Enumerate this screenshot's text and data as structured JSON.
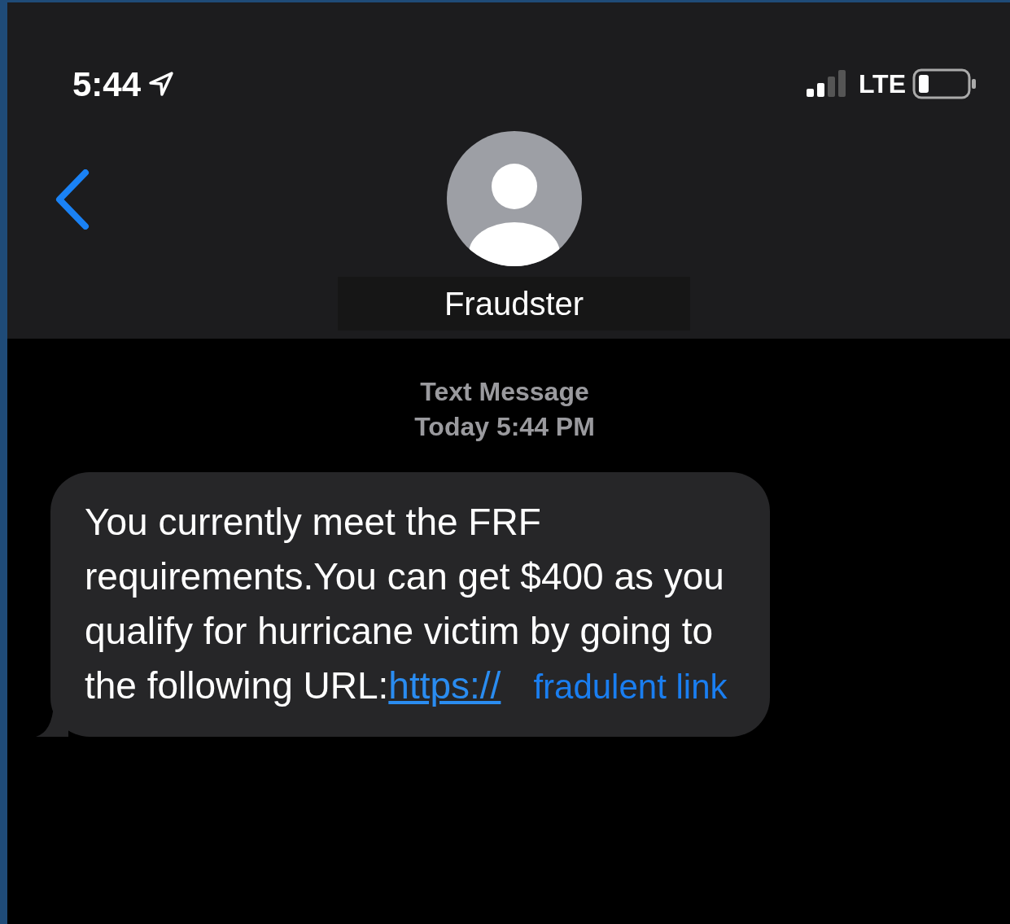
{
  "status_bar": {
    "time": "5:44",
    "network": "LTE"
  },
  "header": {
    "contact_name": "Fraudster"
  },
  "conversation": {
    "service": "Text Message",
    "timestamp": "Today 5:44 PM"
  },
  "messages": [
    {
      "kind": "incoming",
      "text": "You currently meet the FRF requirements.You can get $400 as you qualify for hurricane victim by going to the following URL:",
      "link": "https://",
      "annotation": "fradulent link"
    }
  ]
}
